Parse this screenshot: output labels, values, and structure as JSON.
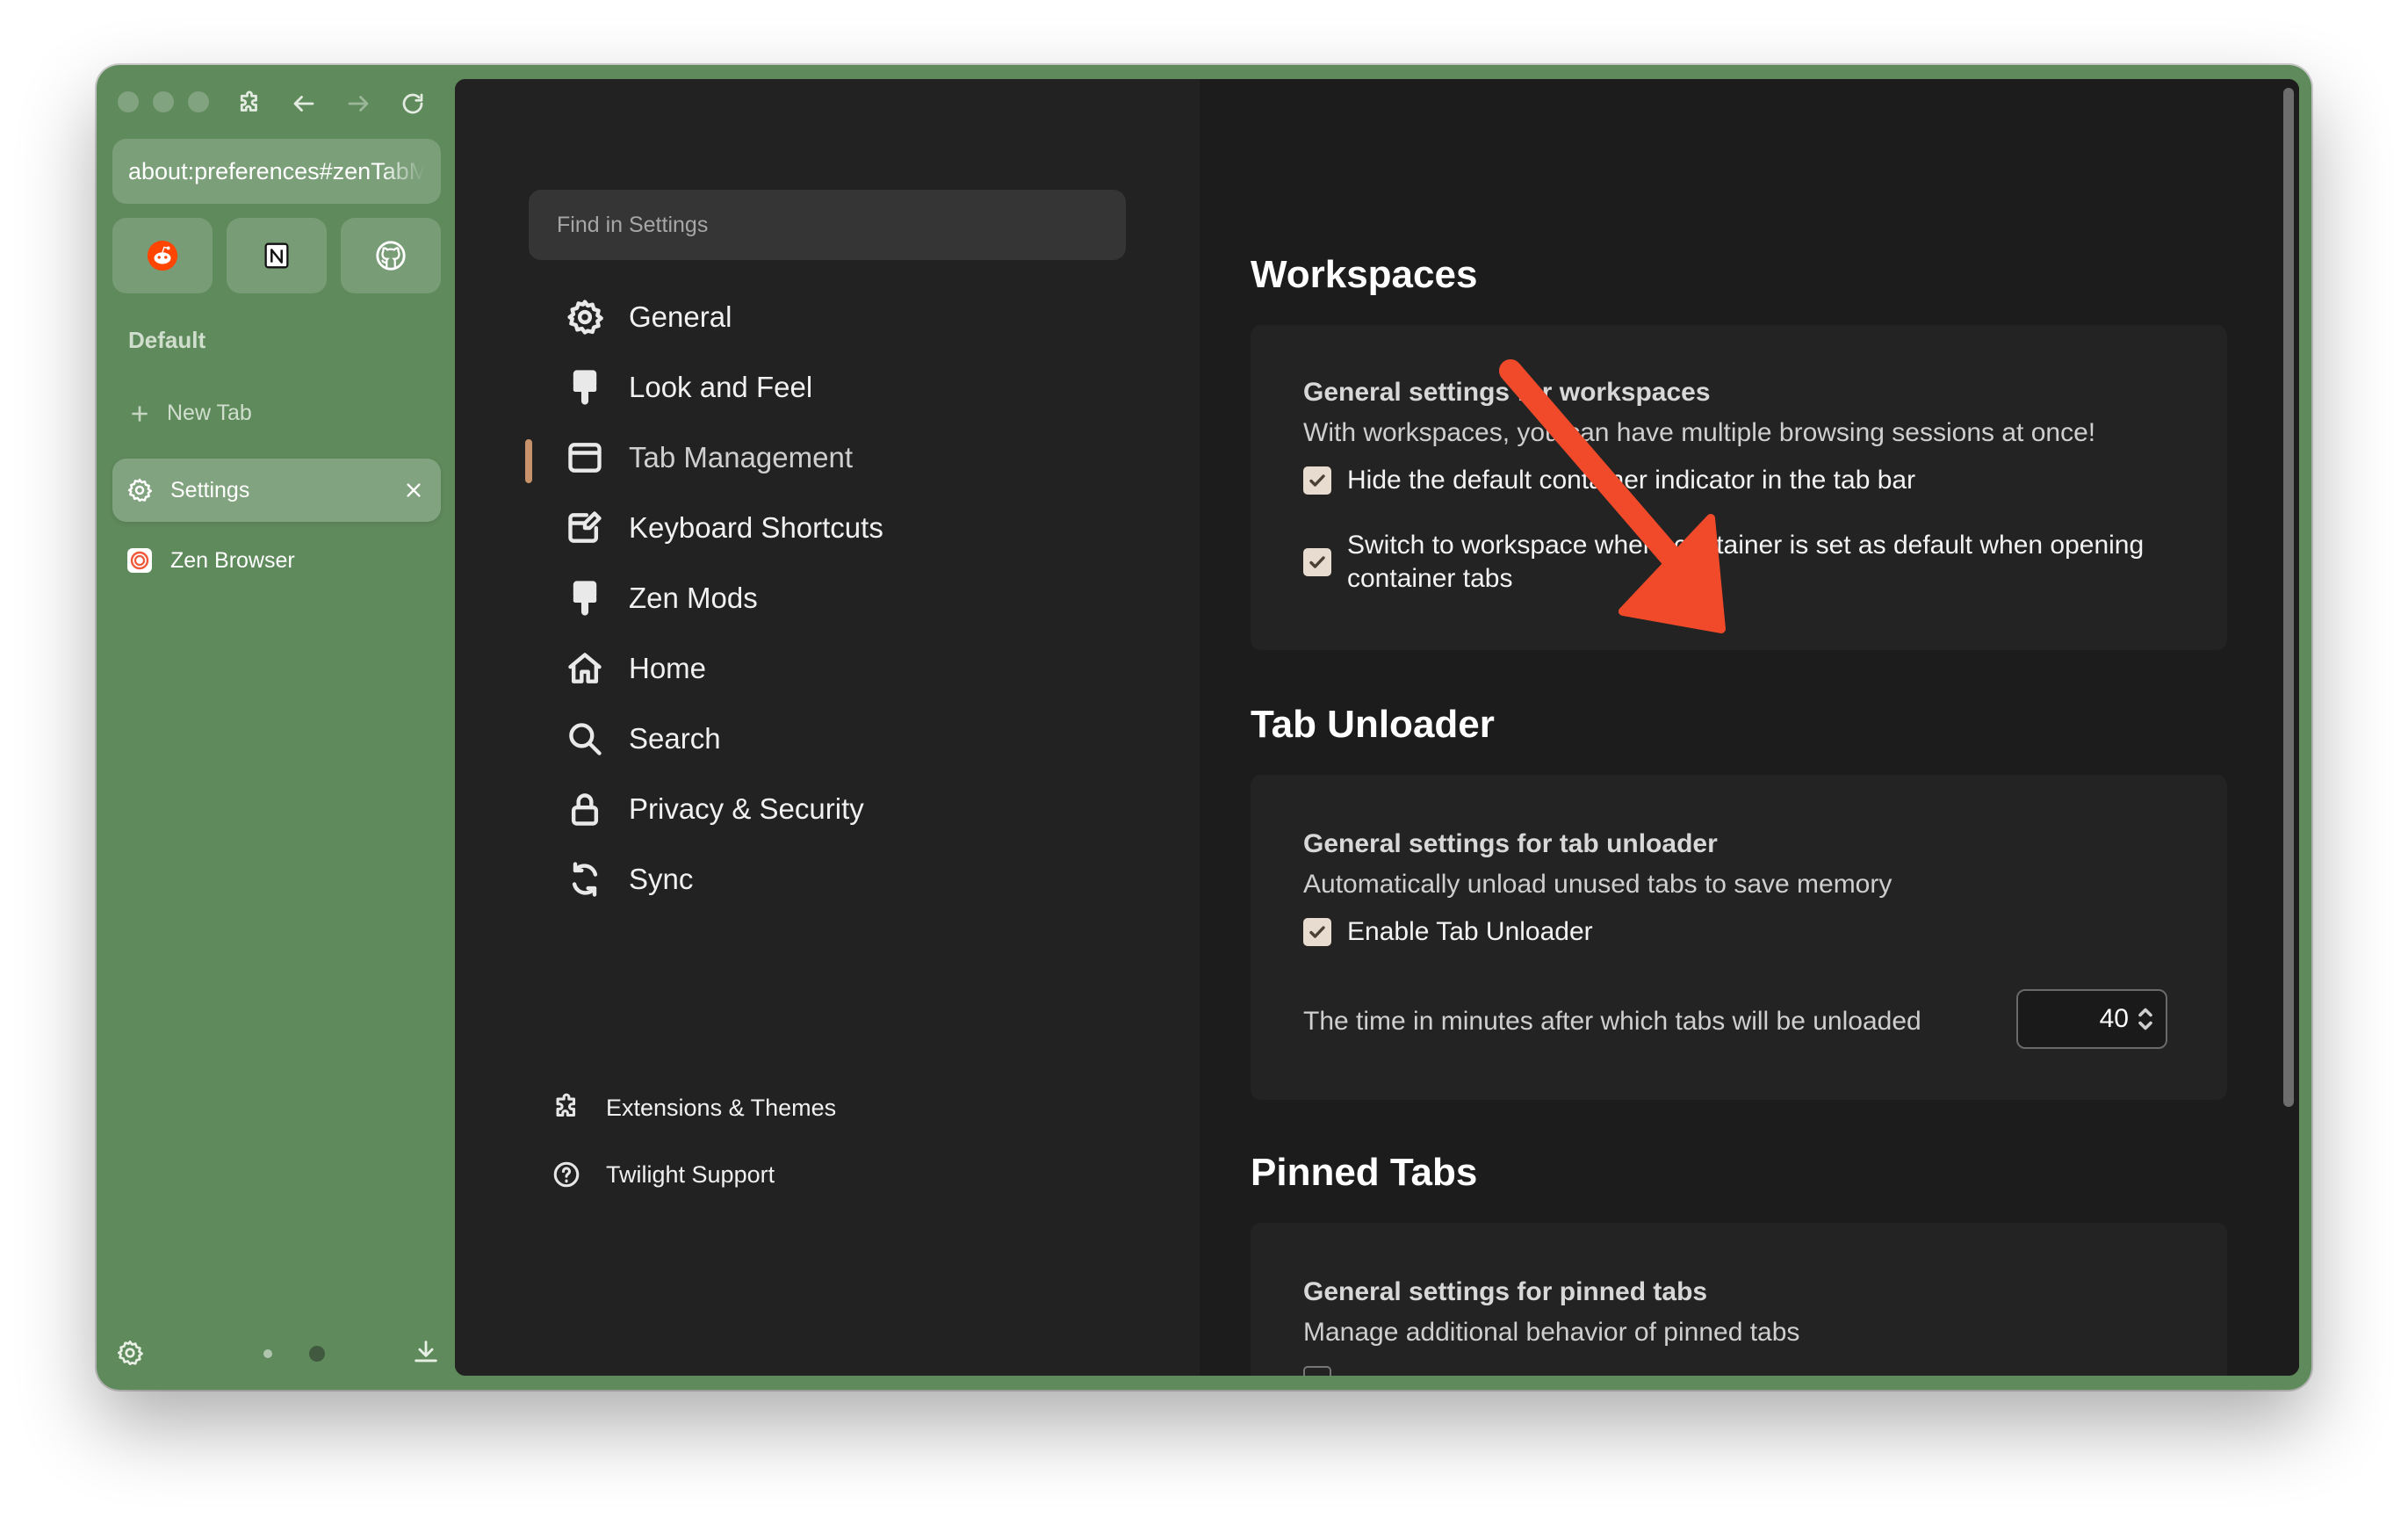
{
  "colors": {
    "accent": "#c8926a",
    "sidebar_bg": "#5f8a5c",
    "arrow": "#f04a2a"
  },
  "window": {
    "url": "about:preferences#zenTabManagement"
  },
  "sidebar": {
    "pinned": [
      {
        "name": "reddit-icon"
      },
      {
        "name": "notion-icon"
      },
      {
        "name": "github-icon"
      }
    ],
    "workspace_label": "Default",
    "new_tab_label": "New Tab",
    "tabs": [
      {
        "label": "Settings",
        "icon": "gear-icon",
        "active": true
      },
      {
        "label": "Zen Browser",
        "icon": "zen-logo-icon",
        "active": false
      }
    ]
  },
  "settings": {
    "search_placeholder": "Find in Settings",
    "categories": [
      {
        "label": "General",
        "icon": "gear-icon"
      },
      {
        "label": "Look and Feel",
        "icon": "paintbrush-icon"
      },
      {
        "label": "Tab Management",
        "icon": "tab-window-icon",
        "selected": true
      },
      {
        "label": "Keyboard Shortcuts",
        "icon": "keyboard-edit-icon"
      },
      {
        "label": "Zen Mods",
        "icon": "paintbrush-icon"
      },
      {
        "label": "Home",
        "icon": "home-icon"
      },
      {
        "label": "Search",
        "icon": "search-icon"
      },
      {
        "label": "Privacy & Security",
        "icon": "lock-icon"
      },
      {
        "label": "Sync",
        "icon": "sync-icon"
      }
    ],
    "footer": [
      {
        "label": "Extensions & Themes",
        "icon": "puzzle-icon"
      },
      {
        "label": "Twilight Support",
        "icon": "help-icon"
      }
    ]
  },
  "sections": {
    "workspaces": {
      "title": "Workspaces",
      "group_title": "General settings for workspaces",
      "group_desc": "With workspaces, you can have multiple browsing sessions at once!",
      "opt1": "Hide the default container indicator in the tab bar",
      "opt2_line1": "Switch to workspace where container is set as default when opening",
      "opt2_line2": "container tabs"
    },
    "unloader": {
      "title": "Tab Unloader",
      "group_title": "General settings for tab unloader",
      "group_desc": "Automatically unload unused tabs to save memory",
      "opt1": "Enable Tab Unloader",
      "timeout_label": "The time in minutes after which tabs will be unloaded",
      "timeout_value": "40"
    },
    "pinned": {
      "title": "Pinned Tabs",
      "group_title": "General settings for pinned tabs",
      "group_desc": "Manage additional behavior of pinned tabs"
    }
  }
}
